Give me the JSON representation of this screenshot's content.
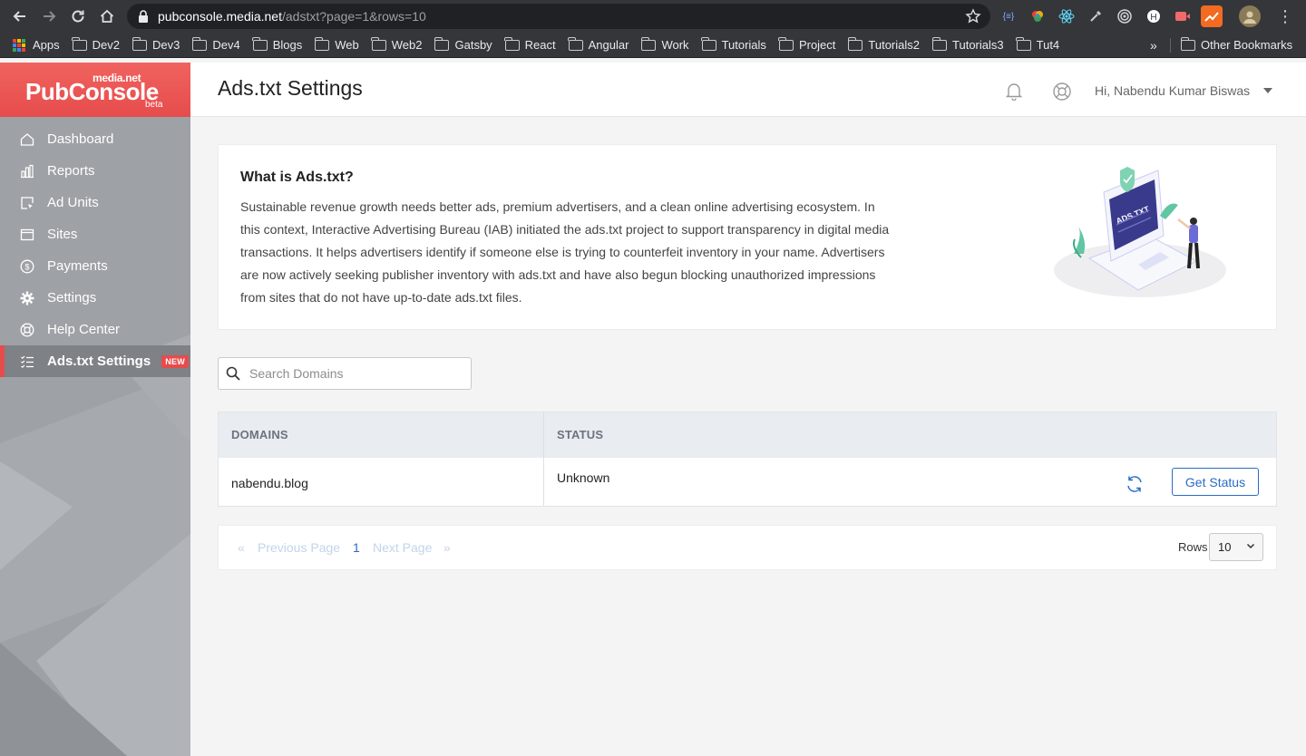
{
  "browser": {
    "url_host": "pubconsole.media.net",
    "url_path": "/adstxt?page=1&rows=10",
    "bookmarks": [
      "Apps",
      "Dev2",
      "Dev3",
      "Dev4",
      "Blogs",
      "Web",
      "Web2",
      "Gatsby",
      "React",
      "Angular",
      "Work",
      "Tutorials",
      "Project",
      "Tutorials2",
      "Tutorials3",
      "Tut4"
    ],
    "more": "»",
    "other_bookmarks": "Other Bookmarks"
  },
  "brand": {
    "small": "media.net",
    "main": "PubConsole",
    "beta": "beta",
    "color": "#e64c4c"
  },
  "sidebar": {
    "items": [
      {
        "label": "Dashboard",
        "icon": "home-icon"
      },
      {
        "label": "Reports",
        "icon": "bar-chart-icon"
      },
      {
        "label": "Ad Units",
        "icon": "ad-unit-icon"
      },
      {
        "label": "Sites",
        "icon": "browser-window-icon"
      },
      {
        "label": "Payments",
        "icon": "dollar-circle-icon"
      },
      {
        "label": "Settings",
        "icon": "gear-icon"
      },
      {
        "label": "Help Center",
        "icon": "lifebuoy-icon"
      },
      {
        "label": "Ads.txt Settings",
        "icon": "checklist-icon",
        "active": true,
        "badge": "NEW"
      }
    ]
  },
  "header": {
    "title": "Ads.txt Settings",
    "greeting": "Hi, Nabendu Kumar Biswas"
  },
  "info": {
    "title": "What is Ads.txt?",
    "body": "Sustainable revenue growth needs better ads, premium advertisers, and a clean online advertising ecosystem. In this context, Interactive Advertising Bureau (IAB) initiated the ads.txt project to support transparency in digital media transactions. It helps advertisers identify if someone else is trying to counterfeit inventory in your name. Advertisers are now actively seeking publisher inventory with ads.txt and have also begun blocking unauthorized impressions from sites that do not have up-to-date ads.txt files.",
    "illustration_text": "ADS.TXT"
  },
  "search": {
    "placeholder": "Search Domains",
    "value": ""
  },
  "table": {
    "headers": [
      "DOMAINS",
      "STATUS"
    ],
    "rows": [
      {
        "domain": "nabendu.blog",
        "status": "Unknown",
        "action": "Get Status"
      }
    ]
  },
  "pagination": {
    "first": "«",
    "prev": "Previous Page",
    "current": "1",
    "next": "Next Page",
    "last": "»",
    "rows_label": "Rows",
    "rows_value": "10"
  },
  "colors": {
    "accent": "#2a6bc6",
    "brand_red": "#e64c4c",
    "sidebar_bg": "#9ea1a6"
  }
}
